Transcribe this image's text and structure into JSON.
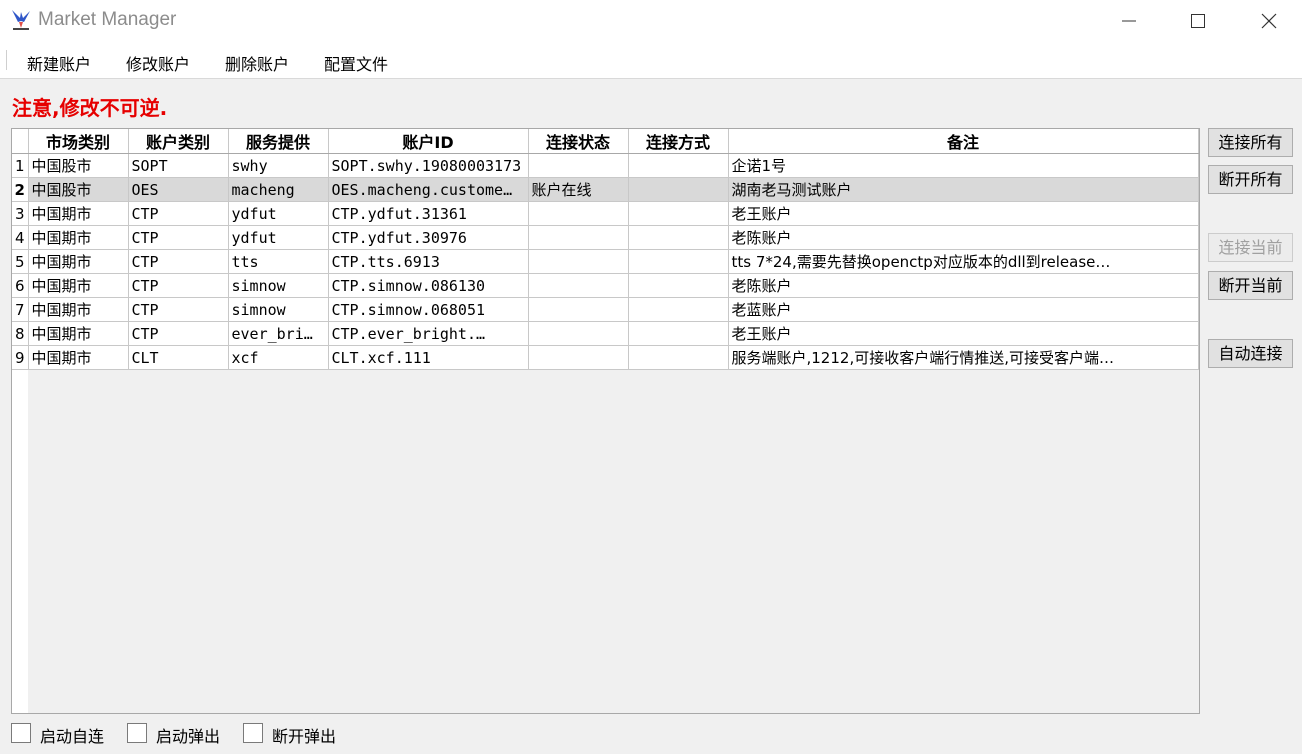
{
  "window": {
    "title": "Market Manager",
    "logo_icon": "falcon-logo-icon"
  },
  "menu": {
    "items": [
      "新建账户",
      "修改账户",
      "删除账户",
      "配置文件"
    ]
  },
  "warning_text": "注意,修改不可逆.",
  "table": {
    "columns": [
      "市场类别",
      "账户类别",
      "服务提供",
      "账户ID",
      "连接状态",
      "连接方式",
      "备注"
    ],
    "selected_row": 2,
    "rows": [
      {
        "num": "1",
        "market": "中国股市",
        "type": "SOPT",
        "provider": "swhy",
        "account_id": "SOPT.swhy.19080003173",
        "status": "",
        "method": "",
        "note": "企诺1号"
      },
      {
        "num": "2",
        "market": "中国股市",
        "type": "OES",
        "provider": "macheng",
        "account_id": "OES.macheng.custome…",
        "status": "账户在线",
        "method": "",
        "note": "湖南老马测试账户"
      },
      {
        "num": "3",
        "market": "中国期市",
        "type": "CTP",
        "provider": "ydfut",
        "account_id": "CTP.ydfut.31361",
        "status": "",
        "method": "",
        "note": "老王账户"
      },
      {
        "num": "4",
        "market": "中国期市",
        "type": "CTP",
        "provider": "ydfut",
        "account_id": "CTP.ydfut.30976",
        "status": "",
        "method": "",
        "note": "老陈账户"
      },
      {
        "num": "5",
        "market": "中国期市",
        "type": "CTP",
        "provider": "tts",
        "account_id": "CTP.tts.6913",
        "status": "",
        "method": "",
        "note": "tts 7*24,需要先替换openctp对应版本的dll到release…"
      },
      {
        "num": "6",
        "market": "中国期市",
        "type": "CTP",
        "provider": "simnow",
        "account_id": "CTP.simnow.086130",
        "status": "",
        "method": "",
        "note": "老陈账户"
      },
      {
        "num": "7",
        "market": "中国期市",
        "type": "CTP",
        "provider": "simnow",
        "account_id": "CTP.simnow.068051",
        "status": "",
        "method": "",
        "note": "老蓝账户"
      },
      {
        "num": "8",
        "market": "中国期市",
        "type": "CTP",
        "provider": "ever_bri…",
        "account_id": "CTP.ever_bright.…",
        "status": "",
        "method": "",
        "note": "老王账户"
      },
      {
        "num": "9",
        "market": "中国期市",
        "type": "CLT",
        "provider": "xcf",
        "account_id": "CLT.xcf.111",
        "status": "",
        "method": "",
        "note": "服务端账户,1212,可接收客户端行情推送,可接受客户端…"
      }
    ]
  },
  "side_buttons": {
    "connect_all": "连接所有",
    "disconnect_all": "断开所有",
    "connect_current": "连接当前",
    "disconnect_current": "断开当前",
    "auto_connect": "自动连接"
  },
  "checkboxes": {
    "auto_connect_on_start": "启动自连",
    "popup_on_start": "启动弹出",
    "popup_on_disconnect": "断开弹出"
  }
}
